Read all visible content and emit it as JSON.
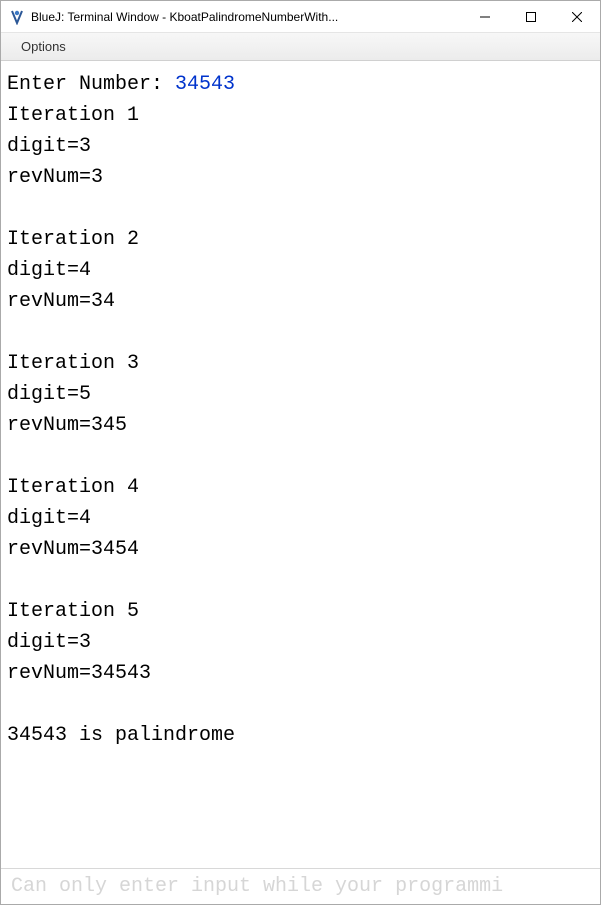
{
  "window": {
    "title": "BlueJ: Terminal Window - KboatPalindromeNumberWith..."
  },
  "menubar": {
    "options": "Options"
  },
  "terminal": {
    "prompt": "Enter Number: ",
    "user_input": "34543",
    "lines": [
      "Iteration 1",
      "digit=3",
      "revNum=3",
      "",
      "Iteration 2",
      "digit=4",
      "revNum=34",
      "",
      "Iteration 3",
      "digit=5",
      "revNum=345",
      "",
      "Iteration 4",
      "digit=4",
      "revNum=3454",
      "",
      "Iteration 5",
      "digit=3",
      "revNum=34543",
      "",
      "34543 is palindrome"
    ]
  },
  "input_bar": {
    "placeholder": "Can only enter input while your programmi"
  }
}
